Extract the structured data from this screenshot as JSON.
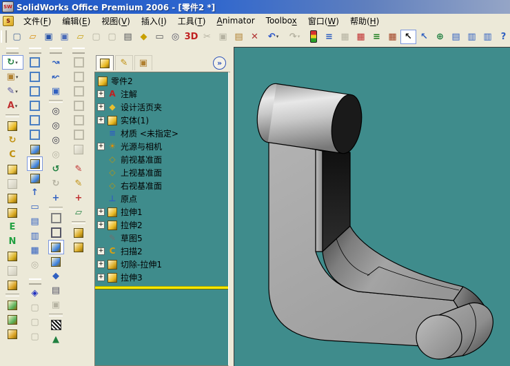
{
  "window": {
    "title": "SolidWorks Office Premium 2006 - [零件2 *]",
    "app_icon_text": "SW",
    "sys_icon_text": "S"
  },
  "ui": {
    "dropdown_glyph": "▾",
    "expand_glyph": "+",
    "overflow_button_glyph": "»"
  },
  "menu": {
    "items": [
      {
        "n": "file",
        "pre": "文件(",
        "mn": "F",
        "post": ")"
      },
      {
        "n": "edit",
        "pre": "编辑(",
        "mn": "E",
        "post": ")"
      },
      {
        "n": "view",
        "pre": "视图(",
        "mn": "V",
        "post": ")"
      },
      {
        "n": "insert",
        "pre": "插入(",
        "mn": "I",
        "post": ")"
      },
      {
        "n": "tools",
        "pre": "工具(",
        "mn": "T",
        "post": ")"
      },
      {
        "n": "animator",
        "pre": "",
        "mn": "A",
        "post": "nimator"
      },
      {
        "n": "toolbox",
        "pre": "Toolbo",
        "mn": "x",
        "post": ""
      },
      {
        "n": "window",
        "pre": "窗口(",
        "mn": "W",
        "post": ")"
      },
      {
        "n": "help",
        "pre": "帮助(",
        "mn": "H",
        "post": ")"
      }
    ]
  },
  "top_toolbar": [
    {
      "t": "grip"
    },
    {
      "n": "new",
      "t": "char",
      "g": "▢",
      "c": "#4a6a9a"
    },
    {
      "n": "open",
      "t": "char",
      "g": "▱",
      "c": "#d89010"
    },
    {
      "n": "save",
      "t": "char",
      "g": "▣",
      "c": "#2853a8"
    },
    {
      "n": "save-all",
      "t": "char",
      "g": "▣",
      "c": "#4a6ab8"
    },
    {
      "n": "make-drawing",
      "t": "char",
      "g": "▱",
      "c": "#c8a010"
    },
    {
      "n": "make-assembly",
      "t": "char",
      "g": "▢",
      "c": "#999",
      "s": "dis"
    },
    {
      "n": "page",
      "t": "char",
      "g": "▢",
      "c": "#999",
      "s": "dis"
    },
    {
      "n": "page-setup",
      "t": "char",
      "g": "▤",
      "c": "#55575a"
    },
    {
      "n": "sw-document",
      "t": "char",
      "g": "◆",
      "c": "#c8a000"
    },
    {
      "n": "print",
      "t": "char",
      "g": "▭",
      "c": "#55575a"
    },
    {
      "n": "print-preview",
      "t": "char",
      "g": "◎",
      "c": "#556"
    },
    {
      "n": "3d-instant-website",
      "t": "char",
      "g": "3D",
      "c": "#c02020"
    },
    {
      "n": "cut",
      "t": "char",
      "g": "✂",
      "c": "#999",
      "s": "dis"
    },
    {
      "n": "copy",
      "t": "char",
      "g": "▣",
      "c": "#999",
      "s": "dis"
    },
    {
      "n": "paste",
      "t": "char",
      "g": "▤",
      "c": "#b08030"
    },
    {
      "n": "delete",
      "t": "char",
      "g": "✕",
      "c": "#b03030"
    },
    {
      "n": "undo",
      "t": "char",
      "g": "↶",
      "c": "#2853c8",
      "s": "dd"
    },
    {
      "n": "redo",
      "t": "char",
      "g": "↷",
      "c": "#999",
      "s": "dis dd"
    },
    {
      "n": "rebuild",
      "t": "traffic"
    },
    {
      "n": "options-list",
      "t": "char",
      "g": "≡",
      "c": "#3060c0"
    },
    {
      "n": "image",
      "t": "char",
      "g": "▦",
      "c": "#999",
      "s": "dis"
    },
    {
      "n": "edit-color",
      "t": "char",
      "g": "▦",
      "c": "#c03030"
    },
    {
      "n": "material-editor",
      "t": "char",
      "g": "≡",
      "c": "#208020"
    },
    {
      "n": "texture",
      "t": "char",
      "g": "▦",
      "c": "#a04020"
    },
    {
      "n": "select",
      "t": "char",
      "g": "↖",
      "c": "#101010",
      "s": "on"
    },
    {
      "n": "selection-filter",
      "t": "char",
      "g": "↖",
      "c": "#3060c0"
    },
    {
      "n": "edrawings-globe",
      "t": "char",
      "g": "⊕",
      "c": "#208040"
    },
    {
      "n": "feature-manager-area",
      "t": "char",
      "g": "▤",
      "c": "#3060c0"
    },
    {
      "n": "task-pane",
      "t": "char",
      "g": "▥",
      "c": "#3060c0"
    },
    {
      "n": "split-panes",
      "t": "char",
      "g": "▥",
      "c": "#3060c0"
    },
    {
      "n": "help",
      "t": "char",
      "g": "?",
      "c": "#3060c0"
    }
  ],
  "left_toolbars": [
    [
      {
        "t": "grip"
      },
      {
        "n": "view-orientation-flyout",
        "t": "char",
        "g": "↻",
        "c": "#208040",
        "s": "on dd"
      },
      {
        "n": "document-properties-flyout",
        "t": "char",
        "g": "▣",
        "c": "#b08030",
        "s": "dd"
      },
      {
        "n": "sketch-flyout",
        "t": "char",
        "g": "✎",
        "c": "#5050a0",
        "s": "dd"
      },
      {
        "n": "annotation-flyout",
        "t": "char",
        "g": "A",
        "c": "#c03030",
        "s": "dd"
      },
      {
        "t": "sep"
      },
      {
        "n": "extruded-boss",
        "t": "cube",
        "c": "#e8b820"
      },
      {
        "n": "revolved-boss",
        "t": "char",
        "g": "↻",
        "c": "#c09010"
      },
      {
        "n": "swept-boss",
        "t": "char",
        "g": "C",
        "c": "#c09010"
      },
      {
        "n": "lofted-boss",
        "t": "cube",
        "c": "#e8c040"
      },
      {
        "n": "thicken",
        "t": "cube",
        "c": "#ccc",
        "s": "dis"
      },
      {
        "n": "extruded-cut",
        "t": "cube",
        "c": "#d8a820"
      },
      {
        "n": "revolved-cut",
        "t": "cube",
        "c": "#d8a820"
      },
      {
        "n": "swept-cut",
        "t": "char",
        "g": "E",
        "c": "#20a040"
      },
      {
        "n": "lofted-cut",
        "t": "char",
        "g": "N",
        "c": "#20a040"
      },
      {
        "n": "hole-wizard",
        "t": "cube",
        "c": "#d8b020"
      },
      {
        "n": "shell",
        "t": "cube",
        "c": "#ccc",
        "s": "dis"
      },
      {
        "n": "rib",
        "t": "cube",
        "c": "#d8a020"
      },
      {
        "t": "sep"
      },
      {
        "n": "fillet",
        "t": "cube",
        "c": "#58b058"
      },
      {
        "n": "chamfer",
        "t": "cube",
        "c": "#58b058"
      },
      {
        "n": "draft",
        "t": "cube",
        "c": "#d8a020"
      }
    ],
    [
      {
        "t": "grip"
      },
      {
        "n": "view-front",
        "t": "cubew",
        "c": "#4a7ec2"
      },
      {
        "n": "view-back",
        "t": "cubew",
        "c": "#4a7ec2"
      },
      {
        "n": "view-left",
        "t": "cubew",
        "c": "#4a7ec2"
      },
      {
        "n": "view-right",
        "t": "cubew",
        "c": "#4a7ec2"
      },
      {
        "n": "view-top",
        "t": "cubew",
        "c": "#4a7ec2"
      },
      {
        "n": "view-bottom",
        "t": "cubew",
        "c": "#4a7ec2"
      },
      {
        "n": "view-isometric",
        "t": "cube",
        "c": "#3a80e0"
      },
      {
        "n": "view-trimetric",
        "t": "cube",
        "c": "#3a80e0",
        "s": "on"
      },
      {
        "n": "view-dimetric",
        "t": "cube",
        "c": "#3a80e0"
      },
      {
        "n": "view-normal-to",
        "t": "char",
        "g": "↑",
        "c": "#3060c0"
      },
      {
        "n": "single-view",
        "t": "char",
        "g": "▭",
        "c": "#3060c0"
      },
      {
        "n": "two-view-horizontal",
        "t": "char",
        "g": "▤",
        "c": "#3060c0"
      },
      {
        "n": "two-view-vertical",
        "t": "char",
        "g": "▥",
        "c": "#3060c0"
      },
      {
        "n": "four-view",
        "t": "char",
        "g": "▦",
        "c": "#3060c0"
      },
      {
        "n": "link-views",
        "t": "char",
        "g": "◎",
        "c": "#999",
        "s": "dis"
      },
      {
        "t": "gap"
      },
      {
        "t": "grip"
      },
      {
        "n": "full-screen",
        "t": "char",
        "g": "◈",
        "c": "#2030c0"
      },
      {
        "n": "zoom-about-1",
        "t": "char",
        "g": "▢",
        "c": "#999",
        "s": "dis"
      },
      {
        "n": "zoom-about-2",
        "t": "char",
        "g": "▢",
        "c": "#999",
        "s": "dis"
      },
      {
        "n": "zoom-about-3",
        "t": "char",
        "g": "▢",
        "c": "#999",
        "s": "dis"
      }
    ],
    [
      {
        "t": "grip"
      },
      {
        "n": "fly-through",
        "t": "char",
        "g": "↝",
        "c": "#3060c0"
      },
      {
        "n": "fly-back",
        "t": "char",
        "g": "↜",
        "c": "#3060c0"
      },
      {
        "n": "3d-drawing-view",
        "t": "char",
        "g": "▣",
        "c": "#3060c0"
      },
      {
        "t": "sep"
      },
      {
        "n": "zoom-to-fit",
        "t": "char",
        "g": "◎",
        "c": "#334"
      },
      {
        "n": "zoom-to-area",
        "t": "char",
        "g": "◎",
        "c": "#334"
      },
      {
        "n": "zoom-in-out",
        "t": "char",
        "g": "◎",
        "c": "#334"
      },
      {
        "n": "zoom-to-selection",
        "t": "char",
        "g": "◎",
        "c": "#999",
        "s": "dis"
      },
      {
        "n": "redraw",
        "t": "char",
        "g": "↺",
        "c": "#208040"
      },
      {
        "n": "rotate-view",
        "t": "char",
        "g": "↻",
        "c": "#999",
        "s": "dis"
      },
      {
        "n": "pan",
        "t": "char",
        "g": "+",
        "c": "#3060c0"
      },
      {
        "t": "sep"
      },
      {
        "n": "wireframe",
        "t": "cubew",
        "c": "#808080"
      },
      {
        "n": "hidden-lines-visible",
        "t": "cubew",
        "c": "#556"
      },
      {
        "n": "shaded-with-edges",
        "t": "cube",
        "c": "#3a80e0",
        "s": "on"
      },
      {
        "n": "shaded",
        "t": "cube",
        "c": "#3a80e0"
      },
      {
        "n": "shadows",
        "t": "char",
        "g": "◆",
        "c": "#3060c0"
      },
      {
        "n": "section-view",
        "t": "char",
        "g": "▤",
        "c": "#556"
      },
      {
        "n": "camera-view",
        "t": "char",
        "g": "▣",
        "c": "#999",
        "s": "dis"
      },
      {
        "t": "sep"
      },
      {
        "n": "zebra-stripes",
        "t": "zebra"
      },
      {
        "n": "realview",
        "t": "char",
        "g": "▲",
        "c": "#208040"
      }
    ],
    [
      {
        "t": "grip"
      },
      {
        "n": "std-view-1",
        "t": "cubew",
        "c": "#b5b2a1",
        "s": "dis"
      },
      {
        "n": "std-view-2",
        "t": "cubew",
        "c": "#b5b2a1",
        "s": "dis"
      },
      {
        "n": "std-view-3",
        "t": "cubew",
        "c": "#b5b2a1",
        "s": "dis"
      },
      {
        "n": "std-view-4",
        "t": "cubew",
        "c": "#b5b2a1",
        "s": "dis"
      },
      {
        "n": "std-view-5",
        "t": "cubew",
        "c": "#b5b2a1",
        "s": "dis"
      },
      {
        "n": "std-view-6",
        "t": "cubew",
        "c": "#b5b2a1",
        "s": "dis"
      },
      {
        "n": "std-view-7",
        "t": "cube",
        "c": "#ccc",
        "s": "dis"
      },
      {
        "t": "gap"
      },
      {
        "n": "3d-sketch",
        "t": "char",
        "g": "✎",
        "c": "#c03030"
      },
      {
        "n": "sketch",
        "t": "char",
        "g": "✎",
        "c": "#c09010"
      },
      {
        "n": "point",
        "t": "char",
        "g": "+",
        "c": "#c03030"
      },
      {
        "n": "convert-entities",
        "t": "char",
        "g": "▱",
        "c": "#208040"
      },
      {
        "t": "sep"
      },
      {
        "n": "feature-tool-1",
        "t": "cube",
        "c": "#d8a820"
      },
      {
        "n": "feature-tool-2",
        "t": "cube",
        "c": "#d8a820"
      }
    ]
  ],
  "feature_panel": {
    "tabs": [
      {
        "n": "featuremanager-tab",
        "t": "cube",
        "c": "#e8b820",
        "active": true
      },
      {
        "n": "propertymanager-tab",
        "t": "char",
        "g": "✎",
        "c": "#c09010",
        "active": false
      },
      {
        "n": "configurationmanager-tab",
        "t": "char",
        "g": "▣",
        "c": "#b08030",
        "active": false
      }
    ],
    "tree": [
      {
        "label": "零件2",
        "t": "cube",
        "c": "#e8b820",
        "expand": false,
        "root": true
      },
      {
        "label": "注解",
        "t": "char",
        "g": "A",
        "c": "#c02020",
        "expand": true
      },
      {
        "label": "设计活页夹",
        "t": "char",
        "g": "◆",
        "c": "#e8c030",
        "expand": true
      },
      {
        "label": "实体(1)",
        "t": "cube",
        "c": "#e8b820",
        "expand": true
      },
      {
        "label": "材质 <未指定>",
        "t": "char",
        "g": "≡",
        "c": "#3060c0",
        "expand": false
      },
      {
        "label": "光源与相机",
        "t": "char",
        "g": "☀",
        "c": "#e09000",
        "expand": true
      },
      {
        "label": "前视基准面",
        "t": "char",
        "g": "◇",
        "c": "#b89810",
        "expand": false
      },
      {
        "label": "上视基准面",
        "t": "char",
        "g": "◇",
        "c": "#b89810",
        "expand": false
      },
      {
        "label": "右视基准面",
        "t": "char",
        "g": "◇",
        "c": "#b89810",
        "expand": false
      },
      {
        "label": "原点",
        "t": "char",
        "g": "⊥",
        "c": "#3060c0",
        "expand": false
      },
      {
        "label": "拉伸1",
        "t": "cube",
        "c": "#e8b820",
        "expand": true
      },
      {
        "label": "拉伸2",
        "t": "cube",
        "c": "#e8b820",
        "expand": true
      },
      {
        "label": "草图5",
        "t": "char",
        "g": "✎",
        "c": "#707070",
        "expand": false
      },
      {
        "label": "扫描2",
        "t": "char",
        "g": "C",
        "c": "#d8a010",
        "expand": true
      },
      {
        "label": "切除-拉伸1",
        "t": "cube",
        "c": "#d8a820",
        "expand": true
      },
      {
        "label": "拉伸3",
        "t": "cube",
        "c": "#e8b820",
        "expand": true
      }
    ],
    "rollback_bar": true
  },
  "viewport": {
    "background_color": "#3F8C8C",
    "part_light_gray": "#ACACAC",
    "part_dark_gray": "#1A1A1A"
  }
}
